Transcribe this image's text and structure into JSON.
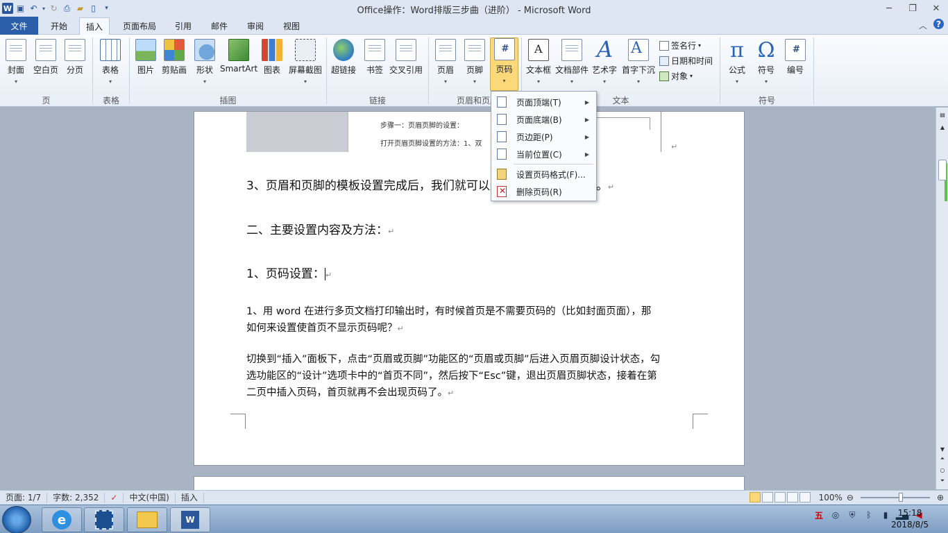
{
  "window": {
    "title": "Office操作：Word排版三步曲（进阶） - Microsoft Word",
    "app_icon": "W"
  },
  "tabs": [
    {
      "label": "文件"
    },
    {
      "label": "开始"
    },
    {
      "label": "插入"
    },
    {
      "label": "页面布局"
    },
    {
      "label": "引用"
    },
    {
      "label": "邮件"
    },
    {
      "label": "审阅"
    },
    {
      "label": "视图"
    }
  ],
  "ribbon": {
    "buttons": {
      "cover": "封面",
      "blank": "空白页",
      "break": "分页",
      "table": "表格",
      "picture": "图片",
      "clipart": "剪贴画",
      "shape": "形状",
      "smartart": "SmartArt",
      "chart": "图表",
      "screenshot": "屏幕截图",
      "hyperlink": "超链接",
      "bookmark": "书签",
      "crossref": "交叉引用",
      "header": "页眉",
      "footer": "页脚",
      "pagenum": "页码",
      "textbox": "文本框",
      "quickparts": "文档部件",
      "wordart": "艺术字",
      "dropcap": "首字下沉",
      "signature": "签名行",
      "datetime": "日期和时间",
      "object": "对象",
      "equation": "公式",
      "symbol": "符号",
      "number": "编号"
    },
    "groups": {
      "pages": "页",
      "tables": "表格",
      "illustrations": "插图",
      "links": "链接",
      "headerfooter": "页眉和页脚",
      "text": "文本",
      "symbols": "符号"
    },
    "symbol_glyphs": {
      "pi": "π",
      "omega": "Ω"
    }
  },
  "menu": {
    "items": [
      {
        "label": "页面顶端(T)",
        "submenu": true
      },
      {
        "label": "页面底端(B)",
        "submenu": true
      },
      {
        "label": "页边距(P)",
        "submenu": true
      },
      {
        "label": "当前位置(C)",
        "submenu": true
      },
      {
        "label": "设置页码格式(F)...",
        "submenu": false
      },
      {
        "label": "删除页码(R)",
        "submenu": false
      }
    ]
  },
  "document": {
    "embed_line1": "步骤一：页眉页脚的设置：",
    "embed_line2": "打开页眉页脚设置的方法：1、双",
    "p1": "3、页眉和页脚的模板设置完成后，我们就可以进行进一步的编辑了。",
    "p2": "二、主要设置内容及方法：",
    "p3": "1、页码设置：",
    "p4a": "1、用 word 在进行多页文档打印输出时，有时候首页是不需要页码的（比如封面页面），那",
    "p4b": "如何来设置使首页不显示页码呢？",
    "p5a": "切换到“插入”面板下，点击“页眉或页脚”功能区的“页眉或页脚”后进入页眉页脚设计状态，勾",
    "p5b": "选功能区的“设计”选项卡中的“首页不同”，然后按下“Esc”键，退出页眉页脚状态，接着在第",
    "p5c": "二页中插入页码，首页就再不会出现页码了。",
    "para_mark": "↵"
  },
  "status": {
    "page": "页面: 1/7",
    "words": "字数: 2,352",
    "lang": "中文(中国)",
    "mode": "插入",
    "zoom": "100%"
  },
  "taskbar": {
    "time": "15:18",
    "date": "2018/8/5"
  }
}
